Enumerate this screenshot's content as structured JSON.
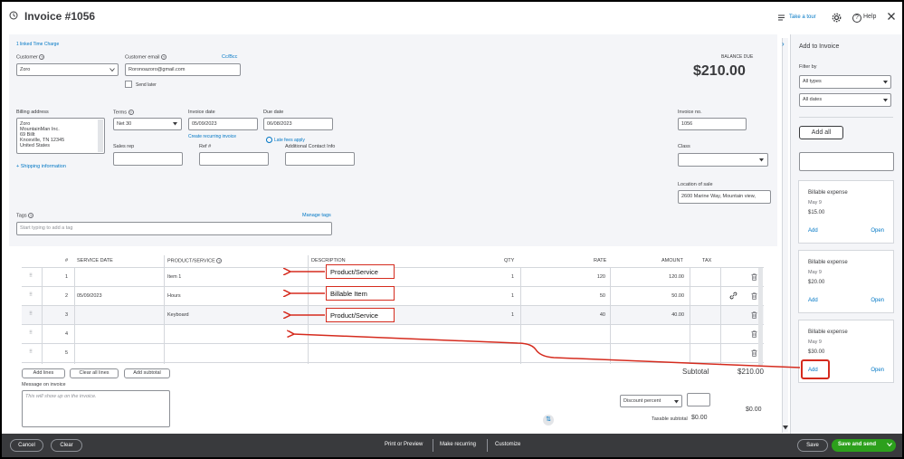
{
  "header": {
    "title": "Invoice #1056",
    "take_tour": "Take a tour",
    "help": "Help"
  },
  "form": {
    "linked_time_charge": "1 linked Time Charge",
    "customer_label": "Customer",
    "customer_value": "Zoro",
    "email_label": "Customer email",
    "email_value": "Roronoazoro@gmail.com",
    "cc_bcc": "Cc/Bcc",
    "send_later": "Send later",
    "balance_due_label": "BALANCE DUE",
    "balance_due_value": "$210.00",
    "billing_label": "Billing address",
    "billing_lines": [
      "Zoro",
      "MountainMan Inc.",
      "69 Billt",
      "Knoxville, TN 12345",
      "United States"
    ],
    "terms_label": "Terms",
    "terms_value": "Net 30",
    "invoice_date_label": "Invoice date",
    "invoice_date_value": "05/09/2023",
    "create_recurring": "Create recurring invoice",
    "due_date_label": "Due date",
    "due_date_value": "06/08/2023",
    "late_fees": "Late fees apply",
    "invoice_no_label": "Invoice no.",
    "invoice_no_value": "1056",
    "shipping_info": "+ Shipping information",
    "sales_rep_label": "Sales rep",
    "ref_label": "Ref #",
    "contact_label": "Additional Contact Info",
    "class_label": "Class",
    "location_label": "Location of sale",
    "location_value": "2600 Marine Way, Mountain view,",
    "tags_label": "Tags",
    "manage_tags": "Manage tags",
    "tags_placeholder": "Start typing to add a tag"
  },
  "table": {
    "headers": {
      "num": "#",
      "service_date": "SERVICE DATE",
      "product": "PRODUCT/SERVICE",
      "description": "DESCRIPTION",
      "qty": "QTY",
      "rate": "RATE",
      "amount": "AMOUNT",
      "tax": "TAX"
    },
    "rows": [
      {
        "num": "1",
        "date": "",
        "product": "Item 1",
        "qty": "1",
        "rate": "120",
        "amount": "120.00"
      },
      {
        "num": "2",
        "date": "05/09/2023",
        "product": "Hours",
        "qty": "1",
        "rate": "50",
        "amount": "50.00"
      },
      {
        "num": "3",
        "date": "",
        "product": "Keyboard",
        "qty": "1",
        "rate": "40",
        "amount": "40.00"
      },
      {
        "num": "4",
        "date": "",
        "product": "",
        "qty": "",
        "rate": "",
        "amount": ""
      },
      {
        "num": "5",
        "date": "",
        "product": "",
        "qty": "",
        "rate": "",
        "amount": ""
      }
    ],
    "add_lines": "Add lines",
    "clear_lines": "Clear all lines",
    "add_subtotal": "Add subtotal"
  },
  "annotations": {
    "row1": "Product/Service",
    "row2": "Billable Item",
    "row3": "Product/Service"
  },
  "totals": {
    "subtotal_label": "Subtotal",
    "subtotal_value": "$210.00",
    "discount_select": "Discount percent",
    "taxable_label": "Taxable subtotal",
    "taxable_value": "$0.00",
    "discount_value": "$0.00"
  },
  "message": {
    "label": "Message on invoice",
    "placeholder": "This will show up on the invoice."
  },
  "panel": {
    "title": "Add to Invoice",
    "filter_label": "Filter by",
    "type_filter": "All types",
    "date_filter": "All dates",
    "add_all": "Add all",
    "cards": [
      {
        "title": "Billable expense",
        "date": "May 9",
        "amount": "$15.00",
        "add": "Add",
        "open": "Open"
      },
      {
        "title": "Billable expense",
        "date": "May 9",
        "amount": "$20.00",
        "add": "Add",
        "open": "Open"
      },
      {
        "title": "Billable expense",
        "date": "May 9",
        "amount": "$30.00",
        "add": "Add",
        "open": "Open"
      }
    ]
  },
  "footer": {
    "cancel": "Cancel",
    "clear": "Clear",
    "print_preview": "Print or Preview",
    "make_recurring": "Make recurring",
    "customize": "Customize",
    "save": "Save",
    "save_send": "Save and send"
  },
  "colors": {
    "accent_red": "#d52b1e",
    "link_blue": "#0077c5",
    "save_green": "#2ca01c",
    "footer_bg": "#393a3d"
  }
}
